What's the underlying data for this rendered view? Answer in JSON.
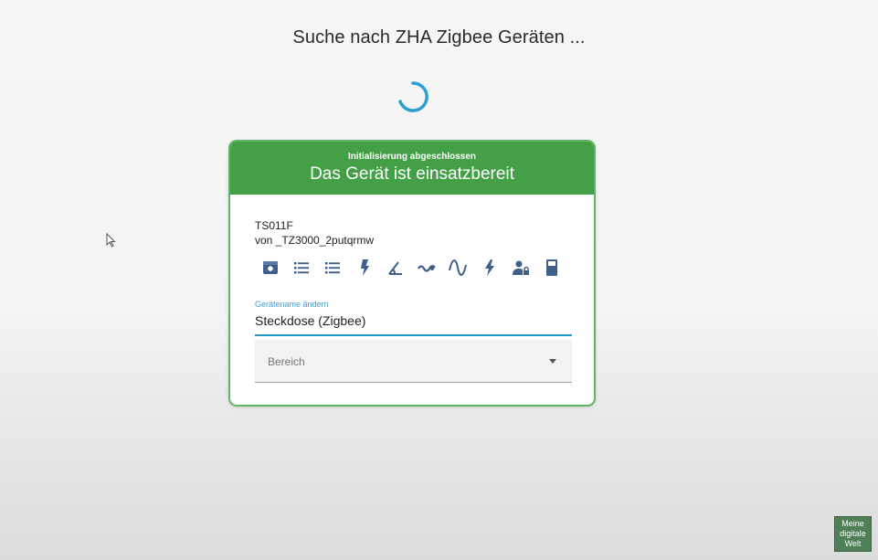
{
  "page": {
    "title": "Suche nach ZHA Zigbee Geräten ..."
  },
  "card": {
    "subtitle": "Initialisierung abgeschlossen",
    "title": "Das Gerät ist einsatzbereit",
    "model": "TS011F",
    "manufacturer": "von _TZ3000_2putqrmw",
    "entity_icons": [
      "switch-icon",
      "list-icon",
      "list-icon",
      "power-icon",
      "angle-icon",
      "current-icon",
      "voltage-icon",
      "flash-icon",
      "lock-person-icon",
      "device-icon"
    ],
    "name_field": {
      "label": "Gerätename ändern",
      "value": "Steckdose (Zigbee)"
    },
    "area_select": {
      "label": "Bereich"
    }
  },
  "watermark": {
    "lines": [
      "Meine",
      "digitale",
      "Welt"
    ]
  },
  "colors": {
    "header": "#43a047",
    "accent": "#2196c9",
    "icons": "#3f5e8a"
  }
}
